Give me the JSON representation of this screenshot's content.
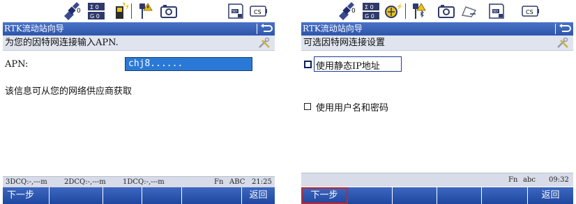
{
  "left_screen": {
    "status_icons": [
      {
        "name": "satellite-icon",
        "text": "0"
      },
      {
        "name": "sigma-icon",
        "text_top": "Σ 0",
        "text_bottom": "G 0"
      },
      {
        "name": "rtk-device-icon"
      },
      {
        "name": "pole-antenna-icon"
      },
      {
        "name": "camera-icon"
      },
      {
        "name": "sd-card-icon",
        "text": "SD"
      },
      {
        "name": "cs-battery-icon",
        "text": "CS"
      }
    ],
    "title": "RTK流动站向导",
    "subtitle": "为您的因特网连接输入APN.",
    "apn_label": "APN:",
    "apn_value": "chj8......",
    "info_text": "该信息可从您的网络供应商获取",
    "status": {
      "dcq3": "3DCQ:-,---m",
      "dcq2": "2DCQ:-,---m",
      "dcq1": "1DCQ:-,---m",
      "fn": "Fn",
      "mode": "ABC",
      "time": "21:25"
    },
    "softkeys": [
      "下一步",
      "",
      "",
      "",
      "",
      "返回"
    ]
  },
  "right_screen": {
    "status_icons": [
      {
        "name": "satellite-icon",
        "text": "0"
      },
      {
        "name": "sigma-icon",
        "text_top": "Σ 0",
        "text_bottom": "G 0"
      },
      {
        "name": "radio-beacon-icon"
      },
      {
        "name": "pole-bluetooth-icon"
      },
      {
        "name": "camera-icon"
      },
      {
        "name": "measure-area-icon"
      },
      {
        "name": "sd-card-icon",
        "text": "SD"
      },
      {
        "name": "cs-battery-icon",
        "text": "CS"
      }
    ],
    "title": "RTK流动站向导",
    "subtitle": "可选因特网连接设置",
    "option_static_ip": "使用静态IP地址",
    "option_user_pass": "使用用户名和密码",
    "status": {
      "fn": "Fn",
      "mode": "abc",
      "time": "09:32"
    },
    "softkeys": [
      "下一步",
      "",
      "",
      "",
      "",
      "返回"
    ]
  },
  "colors": {
    "title_bar": "#2d56ab",
    "input_highlight": "#2a79d6",
    "softkey_selected": "#c8252a"
  }
}
